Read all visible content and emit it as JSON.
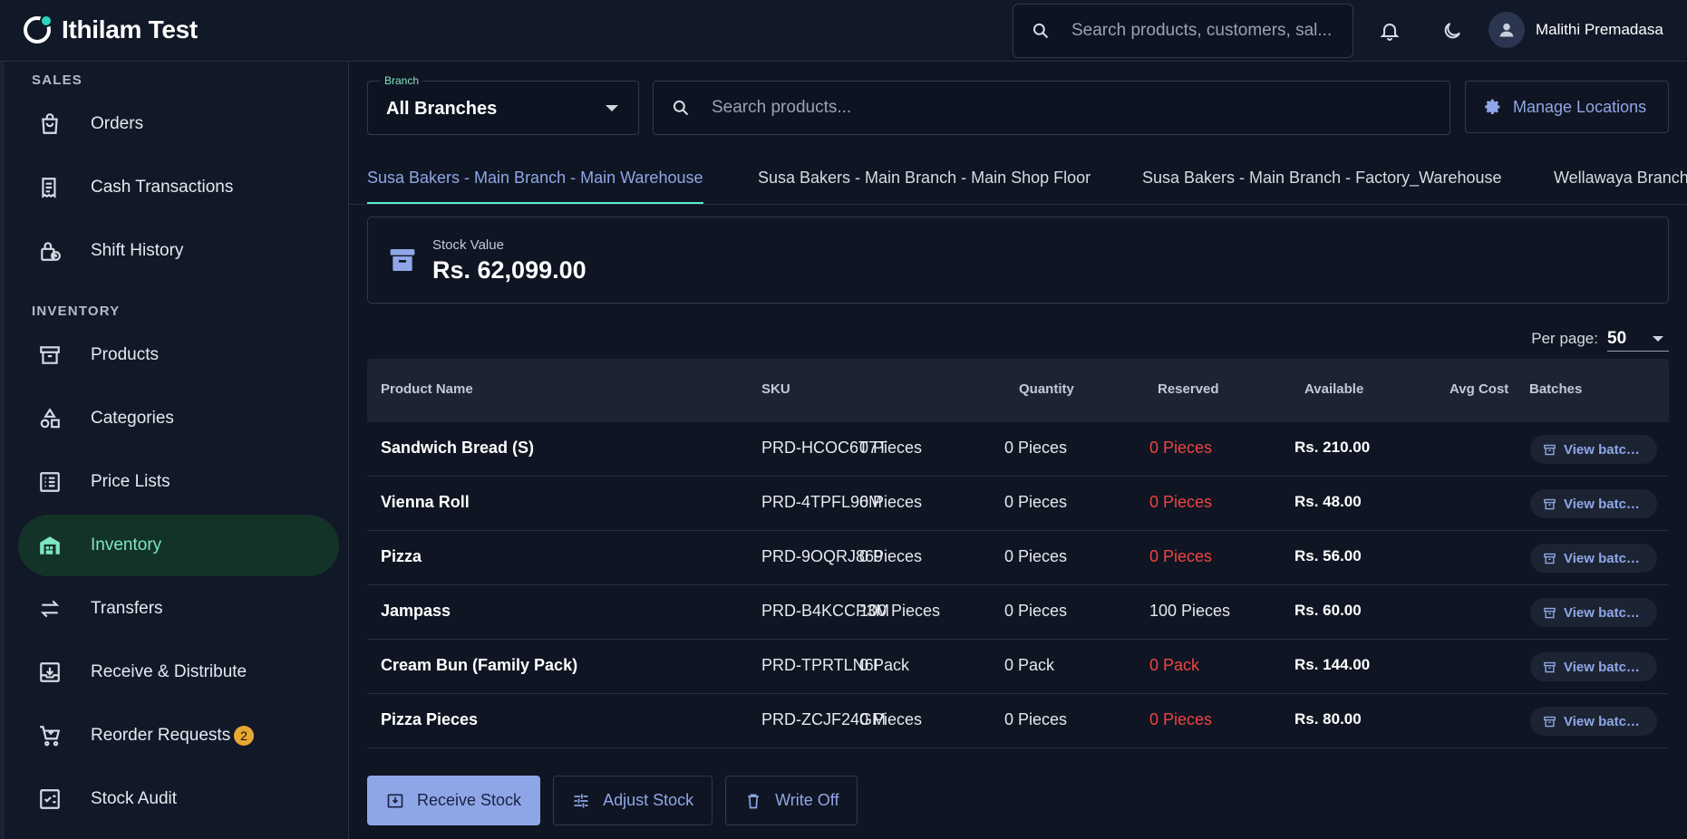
{
  "app": {
    "title": "Ithilam Test"
  },
  "header": {
    "search_placeholder": "Search products, customers, sal...",
    "user_name": "Malithi Premadasa"
  },
  "sidebar": {
    "sections": [
      {
        "label": "SALES"
      },
      {
        "label": "INVENTORY"
      }
    ],
    "items": [
      {
        "label": "Orders",
        "icon": "shopping-bag-icon"
      },
      {
        "label": "Cash Transactions",
        "icon": "receipt-icon"
      },
      {
        "label": "Shift History",
        "icon": "lock-clock-icon"
      },
      {
        "label": "Products",
        "icon": "archive-box-icon"
      },
      {
        "label": "Categories",
        "icon": "shapes-icon"
      },
      {
        "label": "Price Lists",
        "icon": "list-icon"
      },
      {
        "label": "Inventory",
        "icon": "warehouse-icon",
        "active": true
      },
      {
        "label": "Transfers",
        "icon": "swap-arrows-icon"
      },
      {
        "label": "Receive & Distribute",
        "icon": "inbox-download-icon"
      },
      {
        "label": "Reorder Requests",
        "icon": "cart-add-icon",
        "badge": "2"
      },
      {
        "label": "Stock Audit",
        "icon": "checklist-icon"
      }
    ]
  },
  "filters": {
    "branch_legend": "Branch",
    "branch_value": "All Branches",
    "product_search_placeholder": "Search products...",
    "manage_locations": "Manage Locations"
  },
  "tabs": [
    {
      "label": "Susa Bakers - Main Branch - Main Warehouse",
      "active": true
    },
    {
      "label": "Susa Bakers - Main Branch - Main Shop Floor"
    },
    {
      "label": "Susa Bakers - Main Branch - Factory_Warehouse"
    },
    {
      "label": "Wellawaya Branch"
    }
  ],
  "stock": {
    "label": "Stock Value",
    "value": "Rs. 62,099.00"
  },
  "pagination": {
    "per_page_label": "Per page:",
    "per_page_value": "50"
  },
  "table": {
    "columns": [
      "Product Name",
      "SKU",
      "Quantity",
      "Reserved",
      "Available",
      "Avg Cost",
      "Batches"
    ],
    "view_label": "View batches",
    "rows": [
      {
        "name": "Sandwich Bread (S)",
        "sku": "PRD-HCOC6T7T",
        "quantity": "0 Pieces",
        "reserved": "0 Pieces",
        "available": "0 Pieces",
        "available_zero": true,
        "avg_cost": "Rs. 210.00"
      },
      {
        "name": "Vienna Roll",
        "sku": "PRD-4TPFL96M",
        "quantity": "0 Pieces",
        "reserved": "0 Pieces",
        "available": "0 Pieces",
        "available_zero": true,
        "avg_cost": "Rs. 48.00"
      },
      {
        "name": "Pizza",
        "sku": "PRD-9OQRJ869",
        "quantity": "0 Pieces",
        "reserved": "0 Pieces",
        "available": "0 Pieces",
        "available_zero": true,
        "avg_cost": "Rs. 56.00"
      },
      {
        "name": "Jampass",
        "sku": "PRD-B4KCCP3M",
        "quantity": "100 Pieces",
        "reserved": "0 Pieces",
        "available": "100 Pieces",
        "available_zero": false,
        "avg_cost": "Rs. 60.00"
      },
      {
        "name": "Cream Bun (Family Pack)",
        "sku": "PRD-TPRTLN6I",
        "quantity": "0 Pack",
        "reserved": "0 Pack",
        "available": "0 Pack",
        "available_zero": true,
        "avg_cost": "Rs. 144.00"
      },
      {
        "name": "Pizza Pieces",
        "sku": "PRD-ZCJF24GM",
        "quantity": "0 Pieces",
        "reserved": "0 Pieces",
        "available": "0 Pieces",
        "available_zero": true,
        "avg_cost": "Rs. 80.00"
      }
    ]
  },
  "actions": {
    "receive": "Receive Stock",
    "adjust": "Adjust Stock",
    "write_off": "Write Off"
  },
  "colors": {
    "accent": "#8ea6e8",
    "active_nav": "#143328",
    "active_nav_text": "#7ee6c5",
    "danger": "#ef4444",
    "badge": "#e7a730"
  }
}
